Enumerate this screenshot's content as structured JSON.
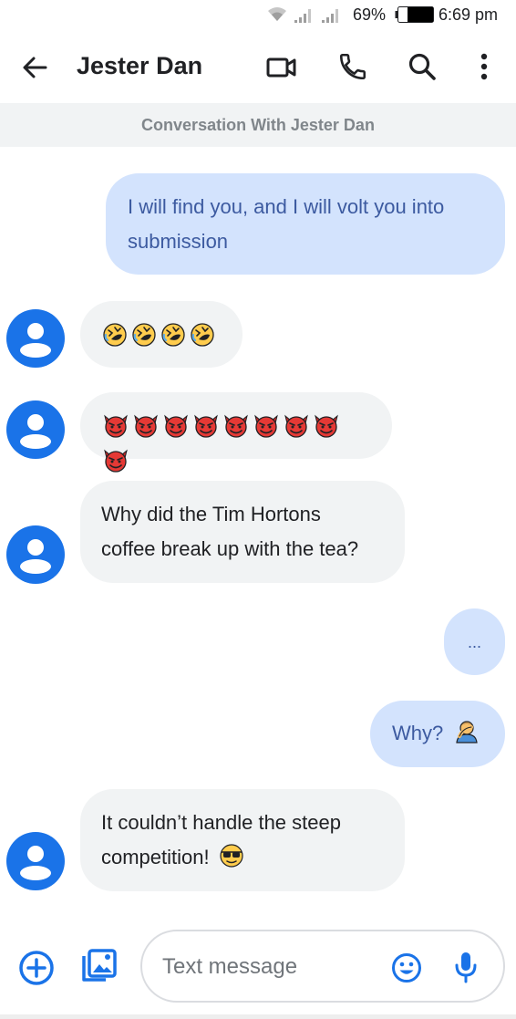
{
  "status_bar": {
    "battery_percent": "69%",
    "time": "6:69 pm"
  },
  "app_bar": {
    "contact_name": "Jester Dan"
  },
  "conversation_header": "Conversation With Jester Dan",
  "messages": [
    {
      "direction": "outgoing",
      "text_line1": "I will find you, and I will volt you into",
      "text_line2": "submission"
    },
    {
      "direction": "incoming",
      "emoji": "rolling-on-the-floor-laughing",
      "emoji_count": 4
    },
    {
      "direction": "incoming",
      "emoji": "smiling-face-with-horns",
      "emoji_count": 9
    },
    {
      "direction": "incoming",
      "text_line1": "Why did the Tim Hortons",
      "text_line2": "coffee break up with the tea?"
    },
    {
      "direction": "outgoing",
      "text": "..."
    },
    {
      "direction": "outgoing",
      "text": "Why?",
      "emoji": "person-facepalming"
    },
    {
      "direction": "incoming",
      "text_line1": "It couldn’t handle the steep",
      "text_line2": "competition!",
      "emoji": "smiling-face-with-sunglasses"
    }
  ],
  "compose": {
    "placeholder": "Text message"
  },
  "colors": {
    "accent": "#1a73e8",
    "outgoing_bubble": "#d3e3fd",
    "incoming_bubble": "#f1f3f4"
  }
}
